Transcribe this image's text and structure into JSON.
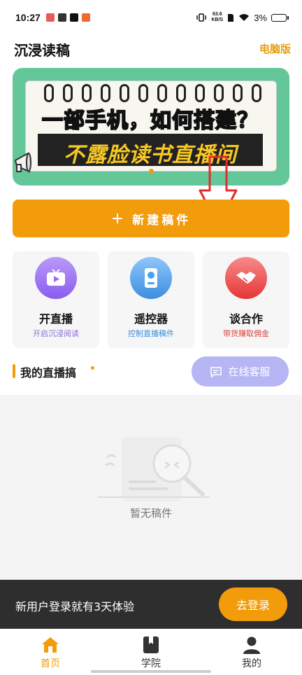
{
  "status_bar": {
    "time": "10:27",
    "speed_value": "63.6",
    "speed_unit": "KB/S",
    "battery": "3%"
  },
  "header": {
    "title": "沉浸读稿",
    "desktop_link": "电脑版"
  },
  "banner": {
    "line1": "一部手机，如何搭建？",
    "line2": "不露脸读书直播间"
  },
  "new_button": {
    "label": "新建稿件"
  },
  "cards": [
    {
      "title": "开直播",
      "subtitle": "开启沉浸阅读",
      "icon": "tv-icon",
      "color": "#9b6bf0",
      "sub_color": "#8a6fd6"
    },
    {
      "title": "遥控器",
      "subtitle": "控制直播稿件",
      "icon": "remote-icon",
      "color": "#4aa2f5",
      "sub_color": "#3d8ee0"
    },
    {
      "title": "谈合作",
      "subtitle": "带货赚取佣金",
      "icon": "handshake-icon",
      "color": "#f0474a",
      "sub_color": "#d94545"
    }
  ],
  "section": {
    "title": "我的直播搞",
    "service_button": "在线客服"
  },
  "empty": {
    "text": "暂无稿件"
  },
  "login_banner": {
    "text": "新用户登录就有3天体验",
    "button": "去登录"
  },
  "bottom_nav": {
    "items": [
      {
        "label": "首页",
        "icon": "home-icon",
        "active": true
      },
      {
        "label": "学院",
        "icon": "book-icon",
        "active": false
      },
      {
        "label": "我的",
        "icon": "user-icon",
        "active": false
      }
    ]
  },
  "colors": {
    "accent": "#f39c0b",
    "banner_green": "#63c79a",
    "service_button": "#b7b6f5"
  }
}
